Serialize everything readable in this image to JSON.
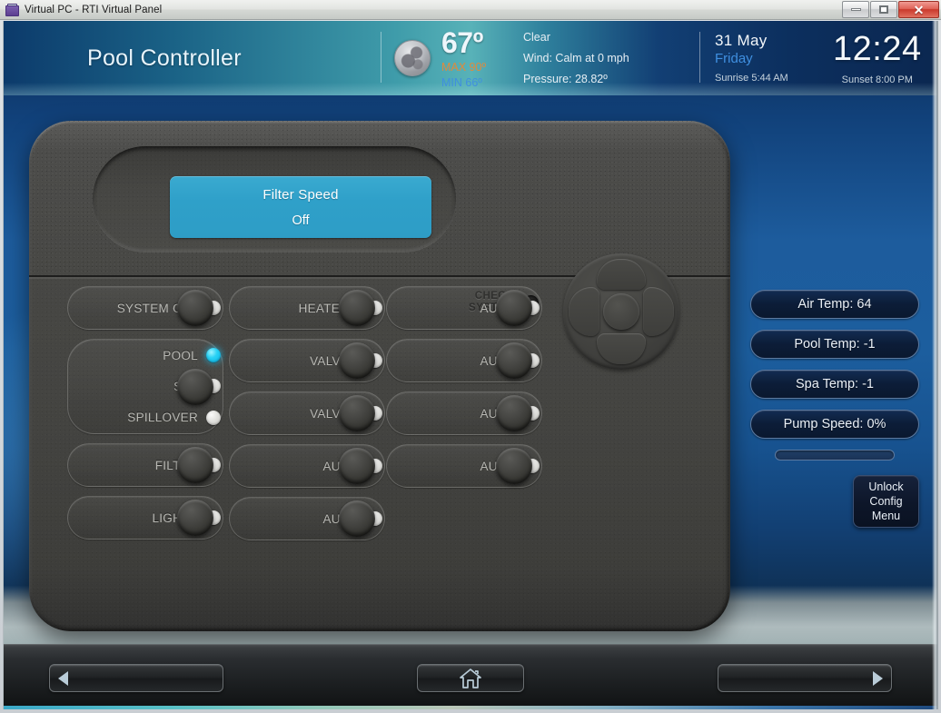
{
  "window": {
    "title": "Virtual PC - RTI Virtual Panel",
    "icon": "virtual-pc-icon",
    "controls": {
      "minimize": "minimize-icon",
      "maximize": "maximize-icon",
      "close": "✕"
    }
  },
  "header": {
    "app_title": "Pool Controller",
    "weather": {
      "icon": "moon-icon",
      "temperature": "67º",
      "max": "MAX 90º",
      "min": "MIN 66º",
      "condition": "Clear",
      "wind": "Wind: Calm at 0 mph",
      "pressure": "Pressure: 28.82º"
    },
    "datetime": {
      "date": "31  May",
      "weekday": "Friday",
      "sunrise": "Sunrise 5:44 AM",
      "time": "12:24",
      "sunset": "Sunset 8:00 PM"
    }
  },
  "device": {
    "lcd": {
      "title": "Filter Speed",
      "value": "Off"
    },
    "check_system": {
      "label_line1": "CHECK",
      "label_line2": "SYSTEM",
      "led_state": "off"
    },
    "dpad": {
      "up": "dpad-up",
      "down": "dpad-down",
      "left": "dpad-left",
      "right": "dpad-right",
      "center": "dpad-center"
    },
    "columns": [
      {
        "id": "col-1",
        "controls": [
          {
            "type": "single",
            "name": "system-off",
            "label": "SYSTEM OFF",
            "led": "off"
          },
          {
            "type": "group",
            "name": "pool-spa-spillover",
            "rows": [
              {
                "name": "pool",
                "label": "POOL",
                "led": "on"
              },
              {
                "name": "spa",
                "label": "SPA",
                "led": "off"
              },
              {
                "name": "spillover",
                "label": "SPILLOVER",
                "led": "off"
              }
            ]
          },
          {
            "type": "single",
            "name": "filter",
            "label": "FILTER",
            "led": "off"
          },
          {
            "type": "single",
            "name": "lights",
            "label": "LIGHTS",
            "led": "off"
          }
        ]
      },
      {
        "id": "col-2",
        "controls": [
          {
            "type": "single",
            "name": "heater-1",
            "label": "HEATER 1",
            "led": "off"
          },
          {
            "type": "single",
            "name": "valve-3",
            "label": "VALVE 3",
            "led": "off"
          },
          {
            "type": "single",
            "name": "valve-4",
            "label": "VALVE 4",
            "led": "off"
          },
          {
            "type": "single",
            "name": "aux-1",
            "label": "AUX 1",
            "led": "off"
          },
          {
            "type": "single",
            "name": "aux-2",
            "label": "AUX 2",
            "led": "off"
          }
        ]
      },
      {
        "id": "col-3",
        "controls": [
          {
            "type": "single",
            "name": "aux-3",
            "label": "AUX 3",
            "led": "off"
          },
          {
            "type": "single",
            "name": "aux-4",
            "label": "AUX 4",
            "led": "off"
          },
          {
            "type": "single",
            "name": "aux-5",
            "label": "AUX 5",
            "led": "off"
          },
          {
            "type": "single",
            "name": "aux-6",
            "label": "AUX 6",
            "led": "off"
          }
        ]
      }
    ]
  },
  "sidebar": {
    "stats": [
      {
        "name": "air-temp",
        "label": "Air Temp: 64"
      },
      {
        "name": "pool-temp",
        "label": "Pool Temp: -1"
      },
      {
        "name": "spa-temp",
        "label": "Spa Temp: -1"
      },
      {
        "name": "pump-speed",
        "label": "Pump Speed: 0%"
      }
    ],
    "pump_slider": {
      "value": 0,
      "max": 100
    },
    "unlock_button": {
      "line1": "Unlock",
      "line2": "Config",
      "line3": "Menu"
    }
  },
  "navbar": {
    "prev": "previous-page",
    "home": "home-icon",
    "next": "next-page"
  },
  "colors": {
    "lcd_cyan": "#2e9dc6",
    "led_on": "#2ad2f5",
    "accent_blue": "#3f8fe0",
    "max_orange": "#e08a3c",
    "header_teal": "#58b2b8",
    "device_gray": "#46463f"
  }
}
